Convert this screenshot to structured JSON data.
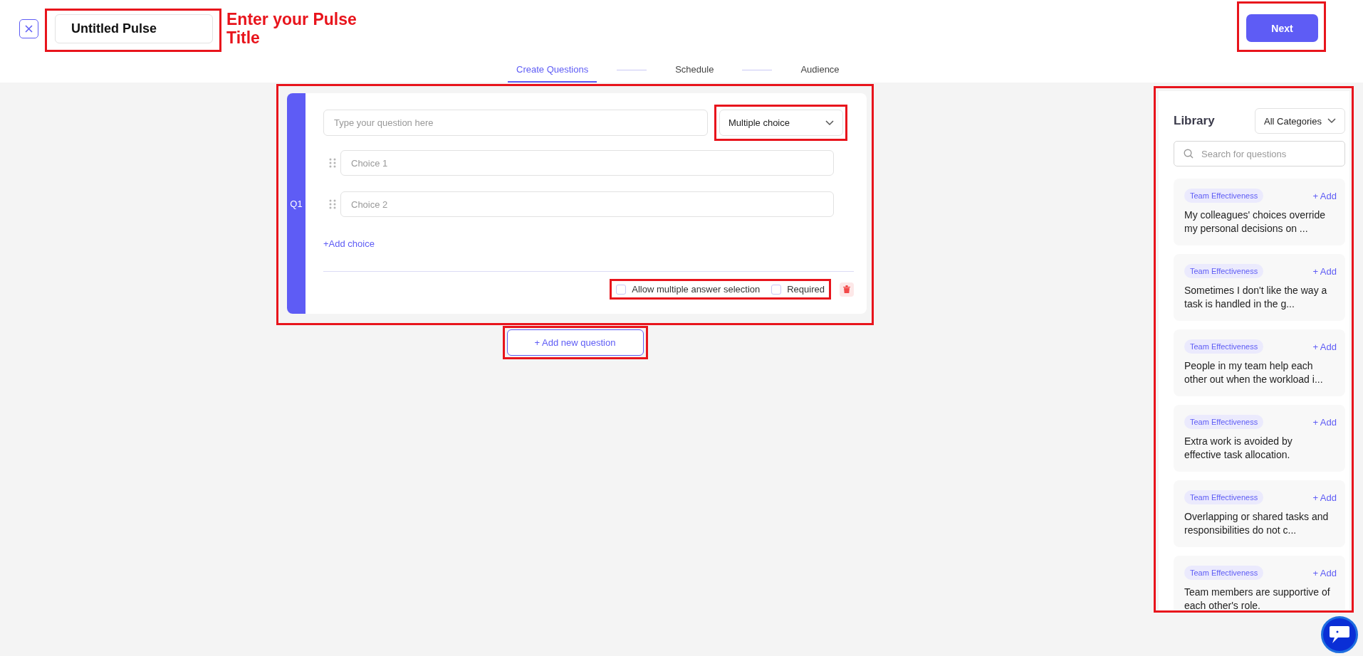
{
  "title_field": {
    "value": "Untitled Pulse"
  },
  "annotation": "Enter your Pulse Title",
  "next_button": "Next",
  "steps": [
    {
      "label": "Create Questions",
      "selected": true
    },
    {
      "label": "Schedule",
      "selected": false
    },
    {
      "label": "Audience",
      "selected": false
    }
  ],
  "question": {
    "number": "Q1",
    "placeholder": "Type your question here",
    "type": "Multiple choice",
    "choices": [
      {
        "placeholder": "Choice 1"
      },
      {
        "placeholder": "Choice 2"
      }
    ],
    "add_choice": "+Add choice",
    "options": [
      {
        "label": "Allow multiple answer selection",
        "checked": false
      },
      {
        "label": "Required",
        "checked": false
      }
    ]
  },
  "add_question_button": "+ Add new question",
  "library": {
    "title": "Library",
    "category": "All Categories",
    "search_placeholder": "Search for questions",
    "items": [
      {
        "tag": "Team Effectiveness",
        "add": "+ Add",
        "text": "My colleagues' choices override my personal decisions on ..."
      },
      {
        "tag": "Team Effectiveness",
        "add": "+ Add",
        "text": "Sometimes I don't like the way a task is handled in the g..."
      },
      {
        "tag": "Team Effectiveness",
        "add": "+ Add",
        "text": "People in my team help each other out when the workload i..."
      },
      {
        "tag": "Team Effectiveness",
        "add": "+ Add",
        "text": "Extra work is avoided by effective task allocation."
      },
      {
        "tag": "Team Effectiveness",
        "add": "+ Add",
        "text": "Overlapping or shared tasks and responsibilities do not c..."
      },
      {
        "tag": "Team Effectiveness",
        "add": "+ Add",
        "text": "Team members are supportive of each other's role."
      }
    ]
  }
}
